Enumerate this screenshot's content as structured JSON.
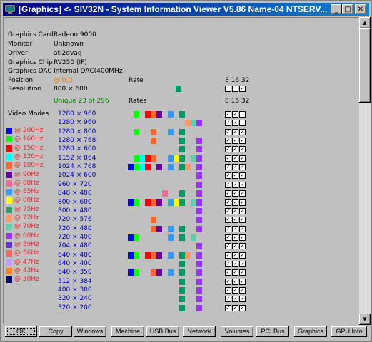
{
  "window": {
    "title": "[Graphics] <- SIV32N - System Information Viewer V5.86 Name-04 NTSERV..."
  },
  "info": [
    {
      "label": "Graphics Card",
      "value": "Radeon 9000"
    },
    {
      "label": "Monitor",
      "value": "Unknown"
    },
    {
      "label": "Driver",
      "value": "ati2dvag"
    },
    {
      "label": "Graphics Chip",
      "value": "RV250 (IF)"
    },
    {
      "label": "Graphics DAC",
      "value": "Internal DAC(400MHz)"
    },
    {
      "label": "Position",
      "value": "@ 0,0"
    },
    {
      "label": "Resolution",
      "value": "800 × 600"
    }
  ],
  "headers": {
    "rate": "Rate",
    "rates": "Rates",
    "unique": "Unique 23 of 296",
    "video_modes": "Video Modes",
    "bpp": "8 16 32"
  },
  "legend": [
    {
      "label": "@ 200Hz",
      "color": "#0000ff"
    },
    {
      "label": "@ 160Hz",
      "color": "#00ff00"
    },
    {
      "label": "@ 150Hz",
      "color": "#ff0000"
    },
    {
      "label": "@ 120Hz",
      "color": "#00ffff"
    },
    {
      "label": "@ 100Hz",
      "color": "#ff6633"
    },
    {
      "label": "@ 90Hz",
      "color": "#660099"
    },
    {
      "label": "@ 88Hz",
      "color": "#ff6699"
    },
    {
      "label": "@ 85Hz",
      "color": "#3399ff"
    },
    {
      "label": "@ 80Hz",
      "color": "#ffff00"
    },
    {
      "label": "@ 75Hz",
      "color": "#339966"
    },
    {
      "label": "@ 72Hz",
      "color": "#ff9966"
    },
    {
      "label": "@ 70Hz",
      "color": "#66ccaa"
    },
    {
      "label": "@ 60Hz",
      "color": "#9933ff"
    },
    {
      "label": "@ 59Hz",
      "color": "#6633cc"
    },
    {
      "label": "@ 56Hz",
      "color": "#ff6666"
    },
    {
      "label": "@ 47Hz",
      "color": "#cc99ff"
    },
    {
      "label": "@ 43Hz",
      "color": "#ff7f27"
    },
    {
      "label": "@ 30Hz",
      "color": "#000066"
    }
  ],
  "modes": [
    {
      "res": "1280 × 960",
      "rates": [
        1,
        3,
        4,
        5,
        7,
        9
      ],
      "bpp": [
        true,
        true,
        false
      ]
    },
    {
      "res": "1280 × 960",
      "rates": [
        10,
        11,
        12
      ],
      "bpp": [
        true,
        true,
        false
      ]
    },
    {
      "res": "1280 × 800",
      "rates": [
        1,
        4,
        7,
        9
      ],
      "bpp": [
        true,
        true,
        true
      ]
    },
    {
      "res": "1280 × 768",
      "rates": [
        4,
        9,
        12
      ],
      "bpp": [
        true,
        true,
        true
      ]
    },
    {
      "res": "1280 × 600",
      "rates": [
        9,
        12
      ],
      "bpp": [
        true,
        true,
        true
      ]
    },
    {
      "res": "1152 × 864",
      "rates": [
        1,
        2,
        3,
        4,
        7,
        8,
        9,
        11,
        12
      ],
      "bpp": [
        true,
        true,
        true
      ]
    },
    {
      "res": "1024 × 768",
      "rates": [
        0,
        1,
        2,
        3,
        5,
        7,
        9,
        10,
        12
      ],
      "bpp": [
        true,
        true,
        true
      ]
    },
    {
      "res": "1024 × 600",
      "rates": [
        12
      ],
      "bpp": [
        true,
        true,
        true
      ]
    },
    {
      "res": "960 × 720",
      "rates": [
        12
      ],
      "bpp": [
        true,
        true,
        true
      ]
    },
    {
      "res": "848 × 480",
      "rates": [
        6,
        9,
        12
      ],
      "bpp": [
        true,
        true,
        true
      ]
    },
    {
      "res": "800 × 600",
      "rates": [
        0,
        1,
        3,
        4,
        5,
        7,
        8,
        9,
        11,
        12
      ],
      "bpp": [
        true,
        true,
        true
      ]
    },
    {
      "res": "800 × 480",
      "rates": [
        12
      ],
      "bpp": [
        true,
        true,
        true
      ]
    },
    {
      "res": "720 × 576",
      "rates": [
        4,
        12
      ],
      "bpp": [
        true,
        true,
        true
      ]
    },
    {
      "res": "720 × 480",
      "rates": [
        4,
        5,
        7,
        9,
        12
      ],
      "bpp": [
        true,
        true,
        true
      ]
    },
    {
      "res": "720 × 400",
      "rates": [
        0,
        1,
        7,
        9,
        11
      ],
      "bpp": [
        true,
        true,
        true
      ]
    },
    {
      "res": "704 × 480",
      "rates": [
        12
      ],
      "bpp": [
        true,
        true,
        true
      ]
    },
    {
      "res": "640 × 480",
      "rates": [
        0,
        1,
        3,
        4,
        5,
        7,
        9,
        10,
        12
      ],
      "bpp": [
        true,
        true,
        true
      ]
    },
    {
      "res": "640 × 400",
      "rates": [
        9,
        12
      ],
      "bpp": [
        true,
        true,
        true
      ]
    },
    {
      "res": "640 × 350",
      "rates": [
        0,
        1,
        4,
        5,
        7,
        9,
        12
      ],
      "bpp": [
        true,
        true,
        true
      ]
    },
    {
      "res": "512 × 384",
      "rates": [
        9,
        12
      ],
      "bpp": [
        true,
        true,
        true
      ]
    },
    {
      "res": "400 × 300",
      "rates": [
        9,
        12
      ],
      "bpp": [
        true,
        true,
        true
      ]
    },
    {
      "res": "320 × 240",
      "rates": [
        9,
        12
      ],
      "bpp": [
        true,
        true,
        true
      ]
    },
    {
      "res": "320 × 200",
      "rates": [
        9,
        12
      ],
      "bpp": [
        true,
        true,
        true
      ]
    }
  ],
  "rate_colors": [
    "#0000ff",
    "#00ff00",
    "#00ffff",
    "#ff0000",
    "#ff6633",
    "#660099",
    "#ff6699",
    "#3399ff",
    "#ffff00",
    "#009966",
    "#ff9966",
    "#66ccaa",
    "#9933ff"
  ],
  "buttons": [
    "OK",
    "Copy",
    "Windows",
    "Machine",
    "USB Bus",
    "Network",
    "Volumes",
    "PCI Bus",
    "Graphics",
    "GPU Info"
  ]
}
